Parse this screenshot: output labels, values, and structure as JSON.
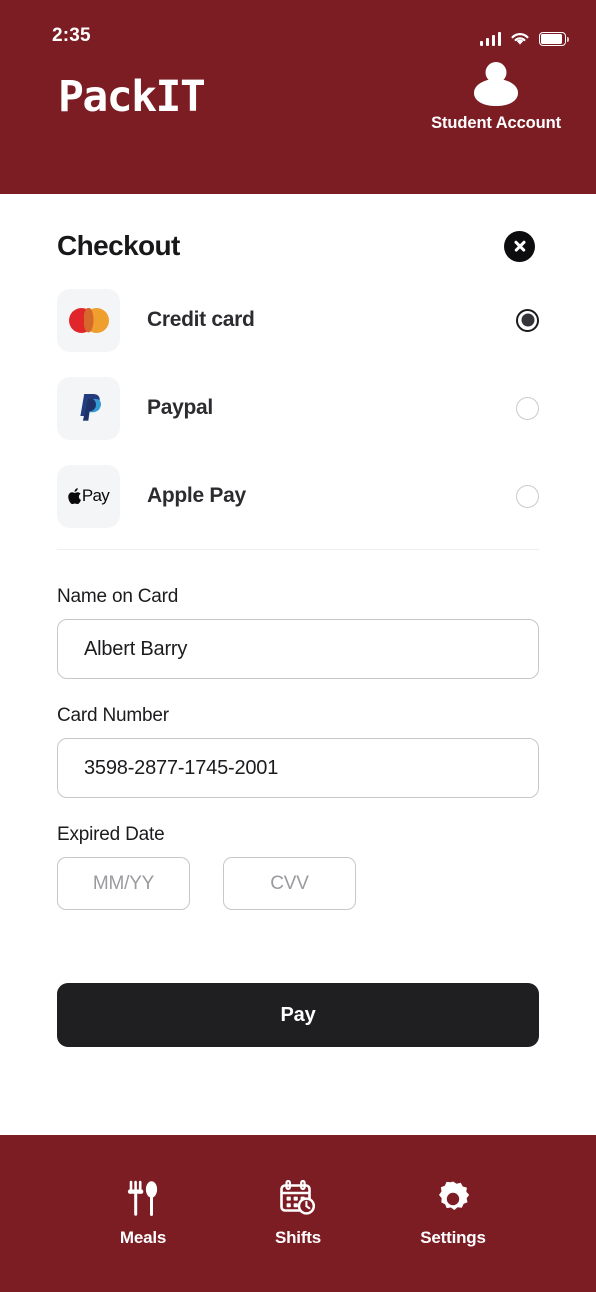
{
  "statusbar": {
    "time": "2:35",
    "signal_icon": "signal-bars-icon",
    "wifi_icon": "wifi-icon",
    "battery_icon": "battery-icon"
  },
  "header": {
    "logo": "PackIT",
    "account_label": "Student Account",
    "avatar_icon": "user-avatar-icon",
    "background_color": "#7C1D24"
  },
  "checkout": {
    "title": "Checkout",
    "close_icon": "close-x-icon"
  },
  "payment_methods": [
    {
      "id": "credit-card",
      "label": "Credit card",
      "logo_icon": "mastercard-icon",
      "selected": true
    },
    {
      "id": "paypal",
      "label": "Paypal",
      "logo_icon": "paypal-icon",
      "selected": false
    },
    {
      "id": "apple-pay",
      "label": "Apple Pay",
      "logo_icon": "apple-pay-icon",
      "apple_pay_text": "Pay",
      "selected": false
    }
  ],
  "form": {
    "name_label": "Name on Card",
    "name_value": "Albert Barry",
    "name_placeholder": "Name on Card",
    "card_label": "Card Number",
    "card_value": "3598-2877-1745-2001",
    "card_placeholder": "Card Number",
    "expiry_label": "Expired Date",
    "expiry_value": "",
    "expiry_placeholder": "MM/YY",
    "cvv_value": "",
    "cvv_placeholder": "CVV",
    "pay_button": "Pay"
  },
  "bottom_nav": [
    {
      "id": "meals",
      "label": "Meals",
      "icon": "fork-spoon-icon"
    },
    {
      "id": "shifts",
      "label": "Shifts",
      "icon": "calendar-clock-icon"
    },
    {
      "id": "settings",
      "label": "Settings",
      "icon": "gear-icon"
    }
  ],
  "colors": {
    "brand": "#7C1D24",
    "button": "#1F1F21",
    "mastercard_red": "#E0262B",
    "mastercard_orange": "#EE9F2E",
    "paypal_dark": "#253B80",
    "paypal_light": "#339AD3"
  }
}
